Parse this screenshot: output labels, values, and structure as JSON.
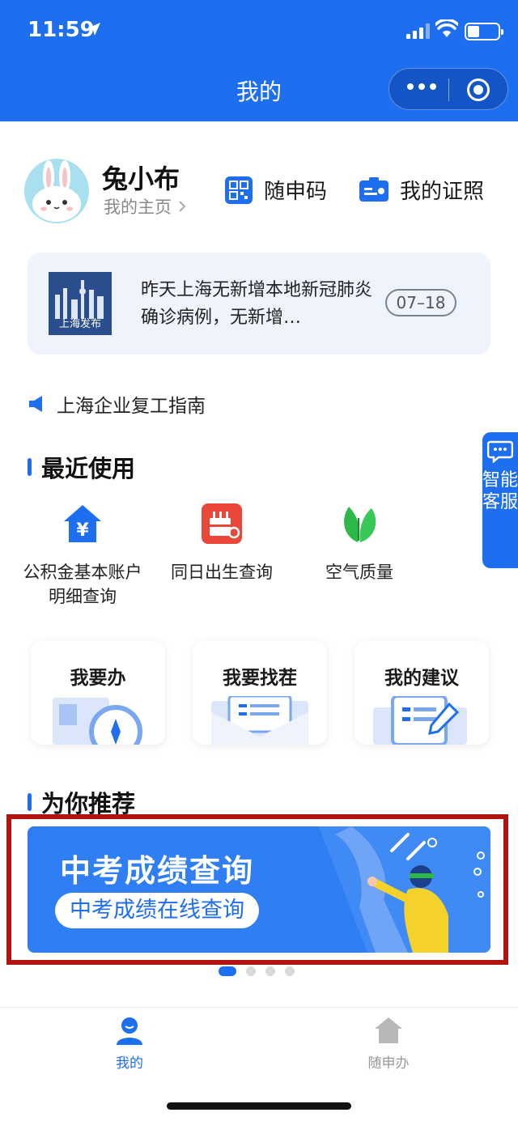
{
  "status_bar": {
    "time": "11:59"
  },
  "header": {
    "title": "我的"
  },
  "profile": {
    "name": "兔小布",
    "homepage_link": "我的主页",
    "qr_code_label": "随申码",
    "license_label": "我的证照"
  },
  "news": {
    "source_logo_text": "上海发布",
    "text": "昨天上海无新增本地新冠肺炎确诊病例，无新增…",
    "date": "07–18"
  },
  "announcement": {
    "text": "上海企业复工指南"
  },
  "recent": {
    "title": "最近使用",
    "items": [
      {
        "label": "公积金基本账户明细查询",
        "icon": "house-yuan-icon"
      },
      {
        "label": "同日出生查询",
        "icon": "birthday-cake-icon"
      },
      {
        "label": "空气质量",
        "icon": "leaf-icon"
      }
    ]
  },
  "features": [
    {
      "label": "我要办",
      "icon": "compass-document-icon"
    },
    {
      "label": "我要找茬",
      "icon": "envelope-icon"
    },
    {
      "label": "我的建议",
      "icon": "clipboard-pen-icon"
    }
  ],
  "recommend": {
    "title": "为你推荐",
    "banner_title": "中考成绩查询",
    "banner_subtitle": "中考成绩在线查询",
    "carousel_index": 1,
    "carousel_count": 4
  },
  "float_service": {
    "label": "智能客服"
  },
  "tabbar": {
    "items": [
      {
        "label": "我的",
        "active": true
      },
      {
        "label": "随申办",
        "active": false
      }
    ]
  },
  "colors": {
    "primary": "#1e6ef0",
    "highlight_frame": "#b0140e",
    "cake_red": "#e8473a",
    "leaf_green": "#2fb84a"
  }
}
